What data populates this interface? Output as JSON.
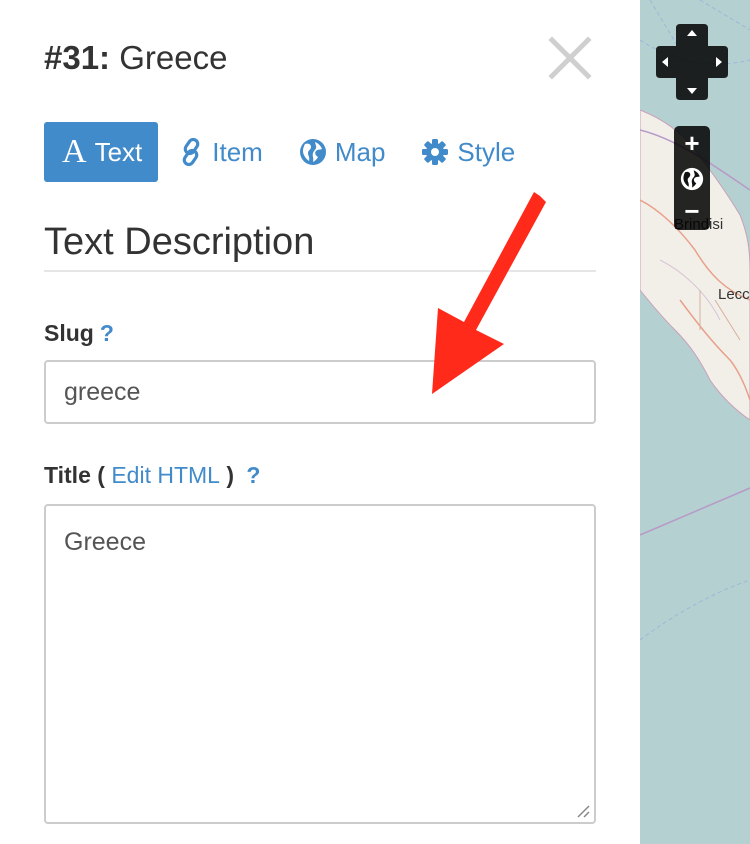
{
  "header": {
    "number": "#31:",
    "title": "Greece"
  },
  "tabs": [
    {
      "label": "Text",
      "icon": "text-glyph-icon",
      "active": true
    },
    {
      "label": "Item",
      "icon": "link-icon",
      "active": false
    },
    {
      "label": "Map",
      "icon": "globe-icon",
      "active": false
    },
    {
      "label": "Style",
      "icon": "gear-icon",
      "active": false
    }
  ],
  "tab_glyph": "A",
  "section": {
    "title": "Text Description"
  },
  "slug": {
    "label": "Slug",
    "help": "?",
    "value": "greece"
  },
  "title_field": {
    "label": "Title",
    "paren_open": "(",
    "edit_link": "Edit HTML",
    "paren_close": ")",
    "help": "?",
    "value": "Greece"
  },
  "map": {
    "places": [
      "Brindisi",
      "Lecc"
    ]
  },
  "colors": {
    "accent": "#428bca",
    "arrow": "#ff2a1a",
    "sea": "#b5d0d0",
    "land": "#f2efe9"
  }
}
